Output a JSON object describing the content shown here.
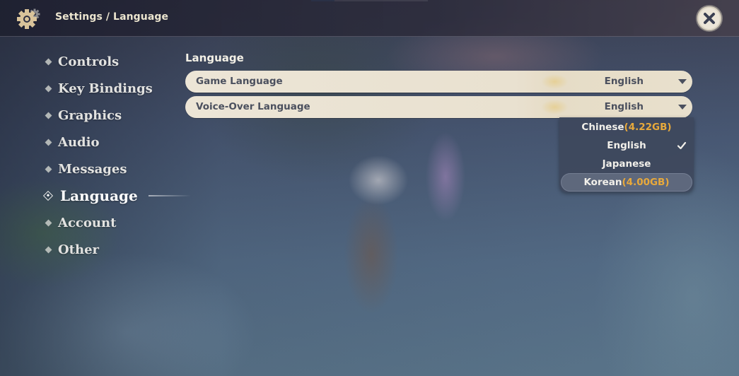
{
  "header": {
    "breadcrumb": "Settings / Language",
    "settings_icon": "gear-icon",
    "close_icon": "close-icon"
  },
  "sidebar": {
    "items": [
      {
        "label": "Controls",
        "active": false
      },
      {
        "label": "Key Bindings",
        "active": false
      },
      {
        "label": "Graphics",
        "active": false
      },
      {
        "label": "Audio",
        "active": false
      },
      {
        "label": "Messages",
        "active": false
      },
      {
        "label": "Language",
        "active": true
      },
      {
        "label": "Account",
        "active": false
      },
      {
        "label": "Other",
        "active": false
      }
    ]
  },
  "main": {
    "section_title": "Language",
    "settings": [
      {
        "label": "Game Language",
        "value": "English"
      },
      {
        "label": "Voice-Over Language",
        "value": "English"
      }
    ],
    "dropdown": {
      "options": [
        {
          "label": "Chinese",
          "size": "(4.22GB)",
          "selected": false,
          "highlighted": false
        },
        {
          "label": "English",
          "size": "",
          "selected": true,
          "highlighted": false
        },
        {
          "label": "Japanese",
          "size": "",
          "selected": false,
          "highlighted": false
        },
        {
          "label": "Korean",
          "size": "(4.00GB)",
          "selected": false,
          "highlighted": true
        }
      ]
    }
  },
  "colors": {
    "accent_gold": "#e8a93b",
    "row_bg": "#ece5d6",
    "row_text": "#4b505e",
    "breadcrumb_text": "#ece5cf"
  }
}
